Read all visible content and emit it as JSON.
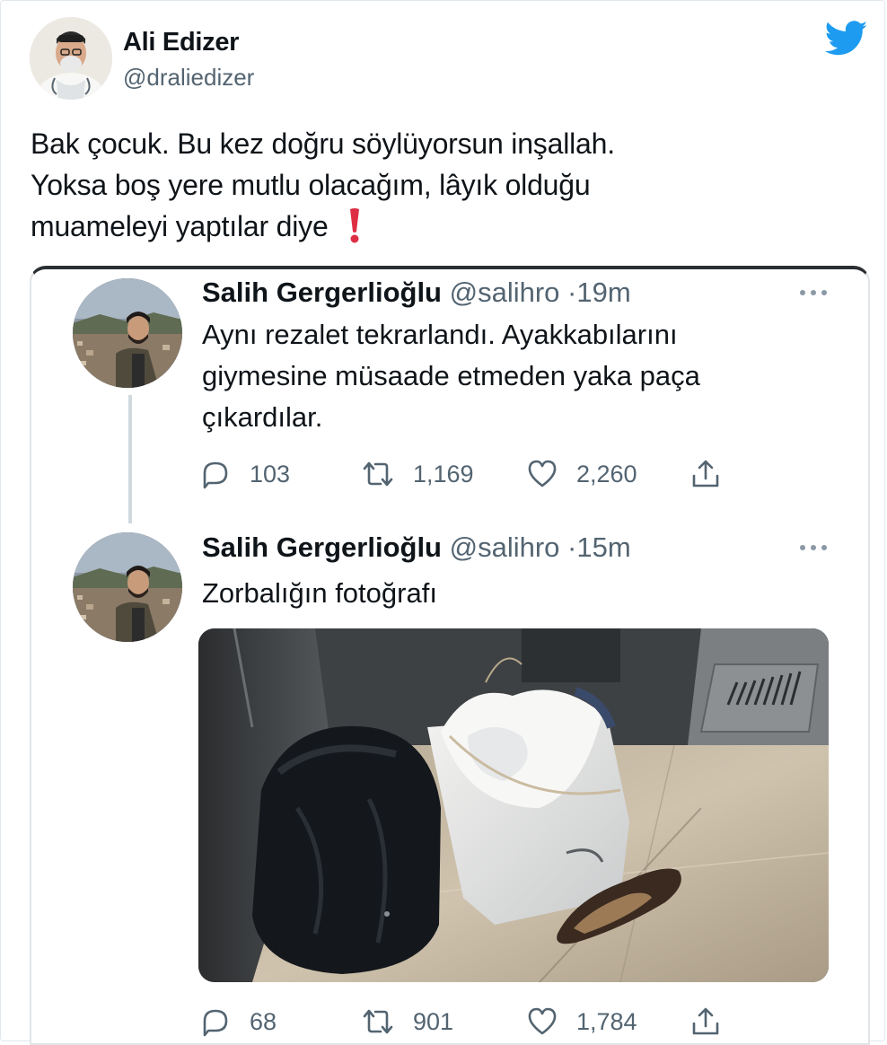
{
  "tweet": {
    "author_name": "Ali Edizer",
    "author_handle": "@draliedizer",
    "text_lines": [
      "Bak çocuk. Bu kez doğru söylüyorsun inşallah.",
      "Yoksa boş yere mutlu olacağım, lâyık olduğu",
      "muameleyi yaptılar diye"
    ],
    "emoji": "exclamation-mark-emoji",
    "logo_icon": "twitter-bird-icon",
    "accent_color": "#1d9bf0"
  },
  "quoted": {
    "tweets": [
      {
        "name": "Salih Gergerlioğlu",
        "handle": "@salihro",
        "separator": "·",
        "time": "19m",
        "lines": [
          "Aynı rezalet tekrarlandı. Ayakkabılarını",
          "giymesine müsaade etmeden yaka paça",
          "çıkardılar."
        ],
        "replies": "103",
        "retweets": "1,169",
        "likes": "2,260"
      },
      {
        "name": "Salih Gergerlioğlu",
        "handle": "@salihro",
        "separator": "·",
        "time": "15m",
        "lines": [
          "Zorbalığın fotoğrafı"
        ],
        "replies": "68",
        "retweets": "901",
        "likes": "1,784"
      }
    ],
    "icons": {
      "reply": "reply-icon",
      "retweet": "retweet-icon",
      "like": "heart-icon",
      "share": "share-icon",
      "more": "more-dots-icon"
    },
    "text_color": "#0f1419",
    "muted_color": "#536471"
  }
}
